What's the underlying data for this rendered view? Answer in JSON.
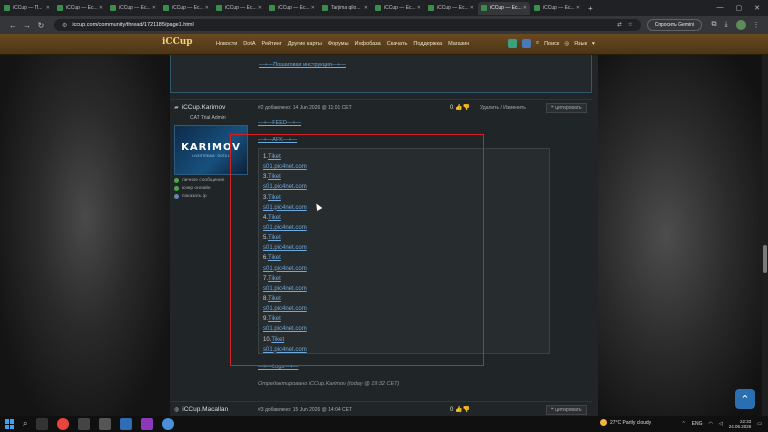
{
  "browser": {
    "tabs": [
      {
        "label": "iCCup — П..."
      },
      {
        "label": "iCCup — Ес..."
      },
      {
        "label": "iCCup — Ес..."
      },
      {
        "label": "iCCup — Ес..."
      },
      {
        "label": "iCCup — Ес..."
      },
      {
        "label": "iCCup — Ес..."
      },
      {
        "label": "Tarjima qilo..."
      },
      {
        "label": "iCCup — Ес..."
      },
      {
        "label": "iCCup — Ес..."
      },
      {
        "label": "iCCup — Ес...",
        "active": true
      },
      {
        "label": "iCCup — Ес..."
      }
    ],
    "new_tab": "+",
    "url": "iccup.com/community/thread/1721185/page1.html",
    "gemini_label": "Спросить Gemini"
  },
  "site": {
    "logo": "iCCup",
    "nav": [
      "Новости",
      "DotA",
      "Рейтинг",
      "Другие карты",
      "Форумы",
      "Инфобаза",
      "Скачать",
      "Поддержка",
      "Магазин"
    ],
    "search_label": "Поиск",
    "lang_label": "Язык"
  },
  "prev_post": {
    "link": "—+—Пошаговая инструкция—+—"
  },
  "post": {
    "author": "iCCup.Karimov",
    "role": "CAT Trial Admin",
    "banner_title": "KARIMOV",
    "banner_sub": "LIVESTREAM · DOTA 1",
    "side_links": [
      "личное сообщение",
      "юзер онлайн",
      "показать ip"
    ],
    "meta": "#2 добавлено: 14 Jun 2026 @ 11:01 CET",
    "rating": "0",
    "actions": "Удалить  /  Изменить",
    "quote": "цитировать",
    "feed": "—+—FEED—+—",
    "afk": "—+—AFK—+—",
    "tickets": [
      {
        "num": "1.",
        "link": "Tiket",
        "host": "s01.pic4net.com"
      },
      {
        "num": "3.",
        "link": "Tiket",
        "host": "s01.pic4net.com"
      },
      {
        "num": "3.",
        "link": "Tiket",
        "host": "s01.pic4net.com"
      },
      {
        "num": "4.",
        "link": "Tiket",
        "host": "s01.pic4net.com"
      },
      {
        "num": "5.",
        "link": "Tiket",
        "host": "s01.pic4net.com"
      },
      {
        "num": "6.",
        "link": "Tiket",
        "host": "s01.pic4net.com"
      },
      {
        "num": "7.",
        "link": "Tiket",
        "host": "s01.pic4net.com"
      },
      {
        "num": "8.",
        "link": "Tiket",
        "host": "s01.pic4net.com"
      },
      {
        "num": "9.",
        "link": "Tiket",
        "host": "s01.pic4net.com"
      },
      {
        "num": "10.",
        "link": "Tiket",
        "host": "s01.pic4net.com"
      }
    ],
    "logs": "—+—Logs—+—",
    "edited": "Отредактировано iCCup.Karimov (today @ 19:32 CET)"
  },
  "post2": {
    "author": "iCCup.Macallan",
    "meta": "#3 добавлено: 15 Jun 2026 @ 14:04 CET",
    "rating": "0",
    "quote": "цитировать"
  },
  "taskbar": {
    "weather": "27°C  Partly cloudy",
    "lang": "ENG",
    "time": "22:33",
    "date": "24.06.2026"
  }
}
